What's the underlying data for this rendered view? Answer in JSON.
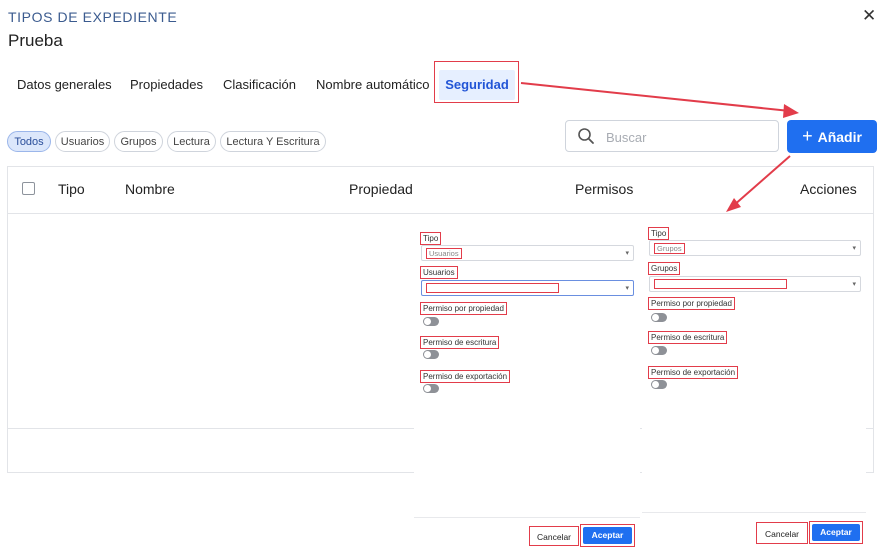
{
  "header": {
    "overline": "TIPOS DE EXPEDIENTE",
    "title": "Prueba",
    "close_glyph": "✕"
  },
  "tabs": [
    {
      "label": "Datos generales"
    },
    {
      "label": "Propiedades"
    },
    {
      "label": "Clasificación"
    },
    {
      "label": "Nombre automático"
    },
    {
      "label": "Seguridad",
      "active": true
    }
  ],
  "filters": [
    {
      "label": "Todos",
      "active": true
    },
    {
      "label": "Usuarios"
    },
    {
      "label": "Grupos"
    },
    {
      "label": "Lectura"
    },
    {
      "label": "Lectura Y Escritura"
    }
  ],
  "search": {
    "placeholder": "Buscar",
    "icon": "search-icon"
  },
  "add_button": {
    "icon_glyph": "+",
    "label": "Añadir"
  },
  "table": {
    "columns": {
      "tipo": "Tipo",
      "nombre": "Nombre",
      "propiedad": "Propiedad",
      "permisos": "Permisos",
      "acciones": "Acciones"
    }
  },
  "form_left": {
    "tipo_label": "Tipo",
    "tipo_value": "Usuarios",
    "select_label": "Usuarios",
    "permiso_propiedad": "Permiso por propiedad",
    "permiso_escritura": "Permiso de escritura",
    "permiso_exportacion": "Permiso de exportación",
    "cancel": "Cancelar",
    "accept": "Aceptar"
  },
  "form_right": {
    "tipo_label": "Tipo",
    "tipo_value": "Grupos",
    "select_label": "Grupos",
    "permiso_propiedad": "Permiso por propiedad",
    "permiso_escritura": "Permiso de escritura",
    "permiso_exportacion": "Permiso de exportación",
    "cancel": "Cancelar",
    "accept": "Aceptar"
  },
  "colors": {
    "accent": "#1f6ff0",
    "annotation": "#e23c4a",
    "tab_active_bg": "#e6efff"
  }
}
